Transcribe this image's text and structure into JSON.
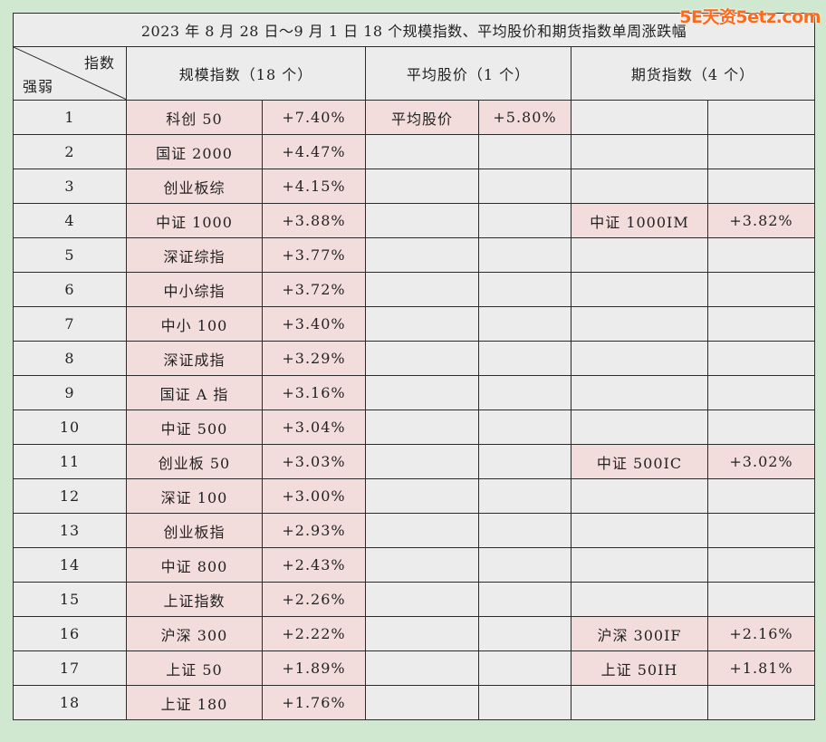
{
  "watermark": "5E天资5etz.com",
  "title": "2023 年 8 月 28 日～9 月 1 日 18 个规模指数、平均股价和期货指数单周涨跌幅",
  "header": {
    "corner_top": "指数",
    "corner_bottom": "强弱",
    "group_scale": "规模指数（18 个）",
    "group_avg": "平均股价（1 个）",
    "group_futures": "期货指数（4 个）"
  },
  "rows": [
    {
      "rank": "1",
      "scale_name": "科创 50",
      "scale_chg": "+7.40%",
      "avg_name": "平均股价",
      "avg_chg": "+5.80%",
      "fut_name": "",
      "fut_chg": ""
    },
    {
      "rank": "2",
      "scale_name": "国证 2000",
      "scale_chg": "+4.47%",
      "avg_name": "",
      "avg_chg": "",
      "fut_name": "",
      "fut_chg": ""
    },
    {
      "rank": "3",
      "scale_name": "创业板综",
      "scale_chg": "+4.15%",
      "avg_name": "",
      "avg_chg": "",
      "fut_name": "",
      "fut_chg": ""
    },
    {
      "rank": "4",
      "scale_name": "中证 1000",
      "scale_chg": "+3.88%",
      "avg_name": "",
      "avg_chg": "",
      "fut_name": "中证 1000IM",
      "fut_chg": "+3.82%"
    },
    {
      "rank": "5",
      "scale_name": "深证综指",
      "scale_chg": "+3.77%",
      "avg_name": "",
      "avg_chg": "",
      "fut_name": "",
      "fut_chg": ""
    },
    {
      "rank": "6",
      "scale_name": "中小综指",
      "scale_chg": "+3.72%",
      "avg_name": "",
      "avg_chg": "",
      "fut_name": "",
      "fut_chg": ""
    },
    {
      "rank": "7",
      "scale_name": "中小 100",
      "scale_chg": "+3.40%",
      "avg_name": "",
      "avg_chg": "",
      "fut_name": "",
      "fut_chg": ""
    },
    {
      "rank": "8",
      "scale_name": "深证成指",
      "scale_chg": "+3.29%",
      "avg_name": "",
      "avg_chg": "",
      "fut_name": "",
      "fut_chg": ""
    },
    {
      "rank": "9",
      "scale_name": "国证 A 指",
      "scale_chg": "+3.16%",
      "avg_name": "",
      "avg_chg": "",
      "fut_name": "",
      "fut_chg": ""
    },
    {
      "rank": "10",
      "scale_name": "中证 500",
      "scale_chg": "+3.04%",
      "avg_name": "",
      "avg_chg": "",
      "fut_name": "",
      "fut_chg": ""
    },
    {
      "rank": "11",
      "scale_name": "创业板 50",
      "scale_chg": "+3.03%",
      "avg_name": "",
      "avg_chg": "",
      "fut_name": "中证 500IC",
      "fut_chg": "+3.02%"
    },
    {
      "rank": "12",
      "scale_name": "深证 100",
      "scale_chg": "+3.00%",
      "avg_name": "",
      "avg_chg": "",
      "fut_name": "",
      "fut_chg": ""
    },
    {
      "rank": "13",
      "scale_name": "创业板指",
      "scale_chg": "+2.93%",
      "avg_name": "",
      "avg_chg": "",
      "fut_name": "",
      "fut_chg": ""
    },
    {
      "rank": "14",
      "scale_name": "中证 800",
      "scale_chg": "+2.43%",
      "avg_name": "",
      "avg_chg": "",
      "fut_name": "",
      "fut_chg": ""
    },
    {
      "rank": "15",
      "scale_name": "上证指数",
      "scale_chg": "+2.26%",
      "avg_name": "",
      "avg_chg": "",
      "fut_name": "",
      "fut_chg": ""
    },
    {
      "rank": "16",
      "scale_name": "沪深 300",
      "scale_chg": "+2.22%",
      "avg_name": "",
      "avg_chg": "",
      "fut_name": "沪深 300IF",
      "fut_chg": "+2.16%"
    },
    {
      "rank": "17",
      "scale_name": "上证 50",
      "scale_chg": "+1.89%",
      "avg_name": "",
      "avg_chg": "",
      "fut_name": "上证 50IH",
      "fut_chg": "+1.81%"
    },
    {
      "rank": "18",
      "scale_name": "上证 180",
      "scale_chg": "+1.76%",
      "avg_name": "",
      "avg_chg": "",
      "fut_name": "",
      "fut_chg": ""
    }
  ],
  "colors": {
    "background": "#cfe8cf",
    "cell": "#ececec",
    "highlight": "#f3dcdc",
    "watermark": "#ff6a1a"
  }
}
